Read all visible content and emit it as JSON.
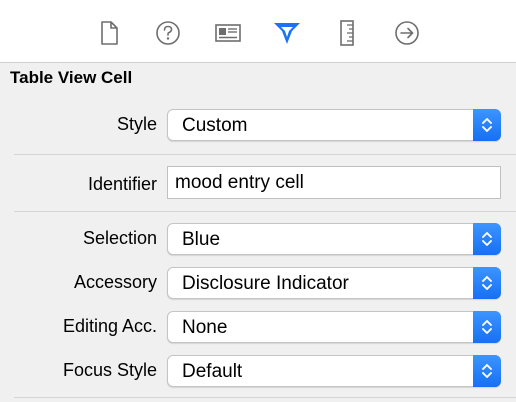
{
  "toolbar": {
    "icons": [
      "file-inspector-icon",
      "quick-help-icon",
      "identity-inspector-icon",
      "attributes-inspector-icon",
      "size-inspector-icon",
      "connections-inspector-icon"
    ],
    "selected": "attributes-inspector-icon",
    "accent": "#1a73f0"
  },
  "section": {
    "title": "Table View Cell"
  },
  "fields": {
    "style": {
      "label": "Style",
      "value": "Custom"
    },
    "identifier": {
      "label": "Identifier",
      "value": "mood entry cell"
    },
    "selection": {
      "label": "Selection",
      "value": "Blue"
    },
    "accessory": {
      "label": "Accessory",
      "value": "Disclosure Indicator"
    },
    "editing_acc": {
      "label": "Editing Acc.",
      "value": "None"
    },
    "focus_style": {
      "label": "Focus Style",
      "value": "Default"
    }
  }
}
